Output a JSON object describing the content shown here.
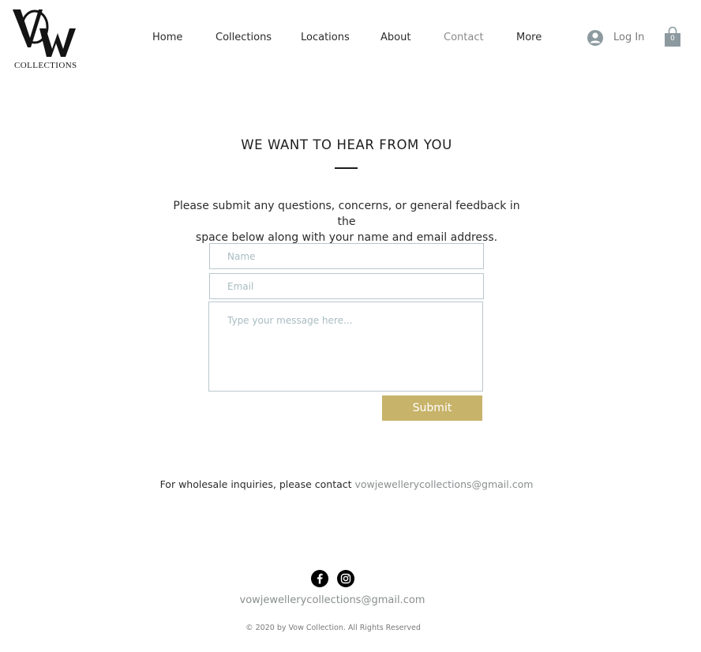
{
  "brand": {
    "logo_text": "VOW",
    "logo_subtitle": "COLLECTIONS"
  },
  "nav": {
    "items": [
      {
        "label": "Home"
      },
      {
        "label": "Collections"
      },
      {
        "label": "Locations"
      },
      {
        "label": "About"
      },
      {
        "label": "Contact",
        "active": true
      },
      {
        "label": "More"
      }
    ],
    "login_label": "Log In",
    "cart_count": "0"
  },
  "contact": {
    "heading": "WE WANT TO HEAR FROM YOU",
    "intro_line1": "Please submit any questions, concerns, or general feedback in the",
    "intro_line2": "space below along with your name and email address.",
    "form": {
      "name_placeholder": "Name",
      "email_placeholder": "Email",
      "message_placeholder": "Type your message here...",
      "submit_label": "Submit"
    },
    "wholesale_text": "For wholesale inquiries, please contact ",
    "wholesale_email": "vowjewellerycollections@gmail.com"
  },
  "footer": {
    "social": [
      "facebook-icon",
      "instagram-icon"
    ],
    "email": "vowjewellerycollections@gmail.com",
    "copyright": "© 2020 by Vow Collection. All Rights Reserved"
  },
  "colors": {
    "accent": "#c8b36a",
    "link": "#8a8e8f",
    "input_border": "#b9c7cc",
    "placeholder": "#a8bcc2",
    "cart": "#8c9aa0"
  }
}
